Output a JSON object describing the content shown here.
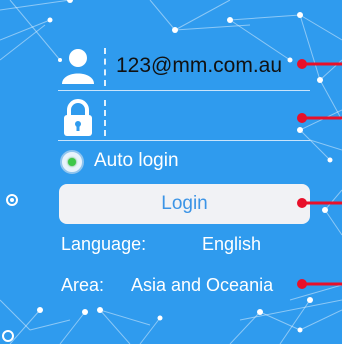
{
  "login_form": {
    "email_value": "123@mm.com.au",
    "password_value": "",
    "auto_login_label": "Auto login",
    "auto_login_checked": true,
    "login_button_label": "Login",
    "language_label": "Language:",
    "language_value": "English",
    "area_label": "Area:",
    "area_value": "Asia and Oceania"
  },
  "icons": {
    "user": "user-icon",
    "lock": "lock-icon",
    "callout": "red-callout-marker"
  },
  "colors": {
    "background": "#2f9bee",
    "button_background": "#f1f2f5",
    "button_text": "#3b94e6",
    "callout_marker": "#e8102a",
    "radio_indicator": "#3cc84a"
  }
}
